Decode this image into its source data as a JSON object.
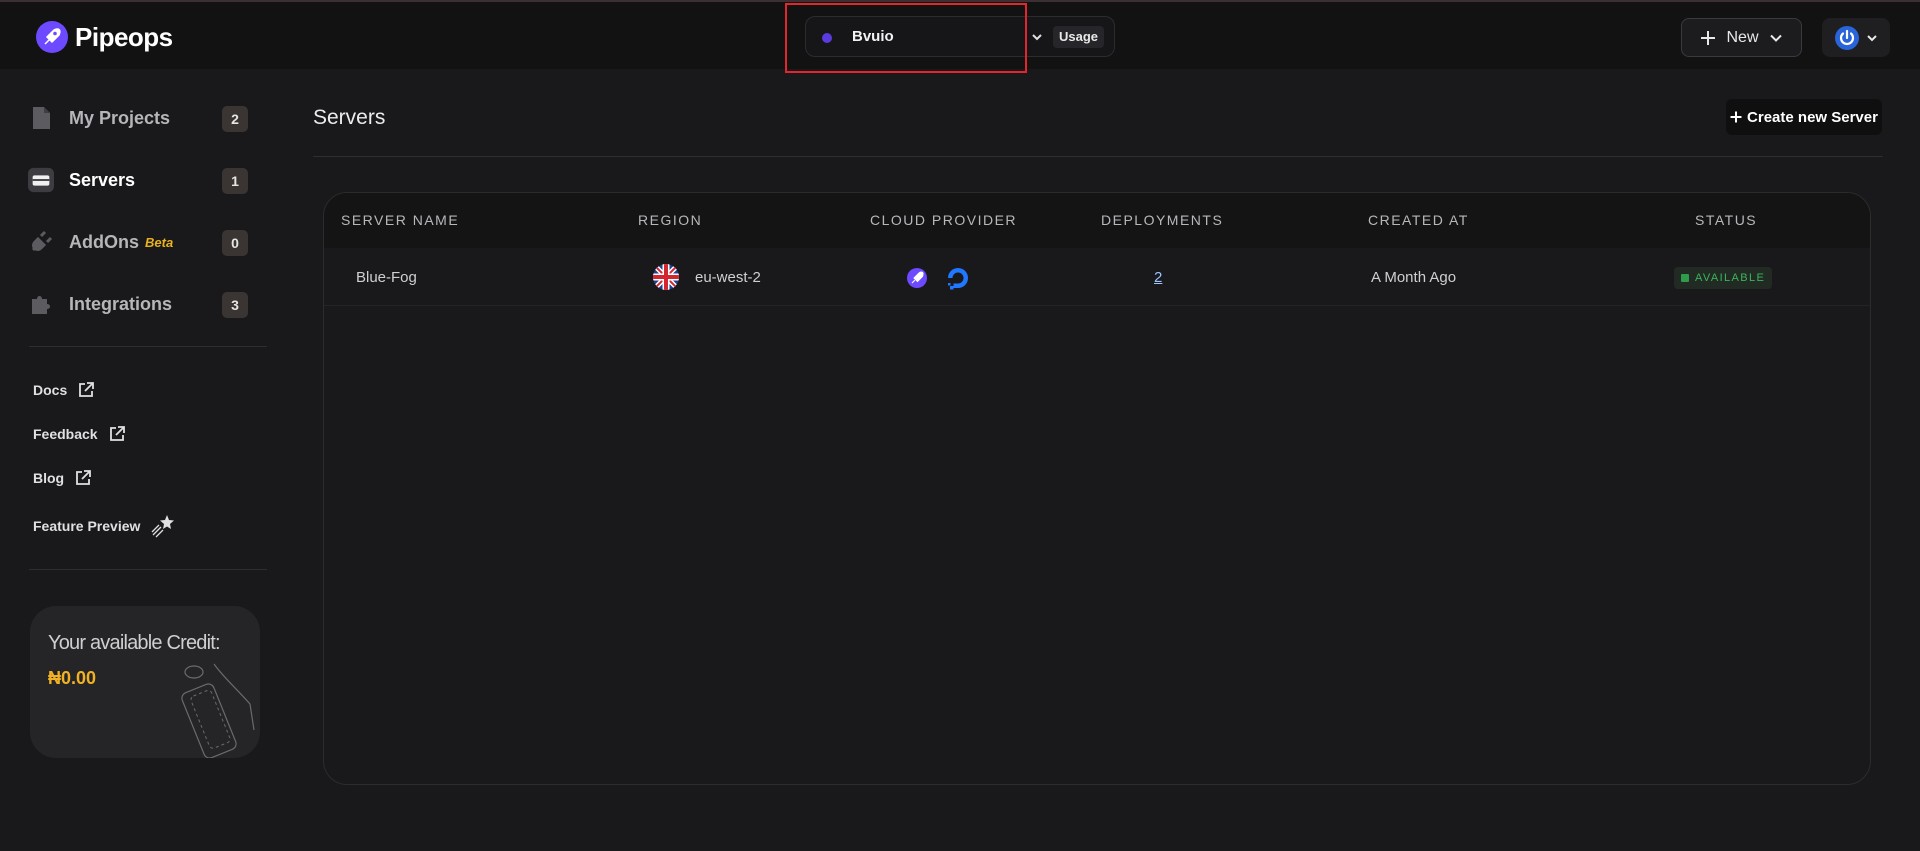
{
  "app": {
    "name": "Pipeops"
  },
  "org_switcher": {
    "org_name": "Bvuio",
    "usage_label": "Usage"
  },
  "header": {
    "new_label": "New"
  },
  "sidebar": {
    "items": [
      {
        "label": "My Projects",
        "count": "2"
      },
      {
        "label": "Servers",
        "count": "1"
      },
      {
        "label": "AddOns",
        "badge": "Beta",
        "count": "0"
      },
      {
        "label": "Integrations",
        "count": "3"
      }
    ],
    "links": [
      {
        "label": "Docs"
      },
      {
        "label": "Feedback"
      },
      {
        "label": "Blog"
      },
      {
        "label": "Feature Preview"
      }
    ],
    "credit": {
      "title": "Your available Credit:",
      "amount": "₦0.00"
    }
  },
  "main": {
    "title": "Servers",
    "create_label": "Create new Server",
    "table": {
      "headers": [
        "SERVER NAME",
        "REGION",
        "CLOUD PROVIDER",
        "DEPLOYMENTS",
        "CREATED AT",
        "STATUS"
      ],
      "rows": [
        {
          "server_name": "Blue-Fog",
          "region": "eu-west-2",
          "deployments": "2",
          "created_at": "A Month Ago",
          "status": "AVAILABLE"
        }
      ]
    }
  },
  "colors": {
    "accent": "#5a3be0",
    "credit": "#f0b224",
    "status_ok": "#3ab55a",
    "highlight": "#e3262d"
  }
}
